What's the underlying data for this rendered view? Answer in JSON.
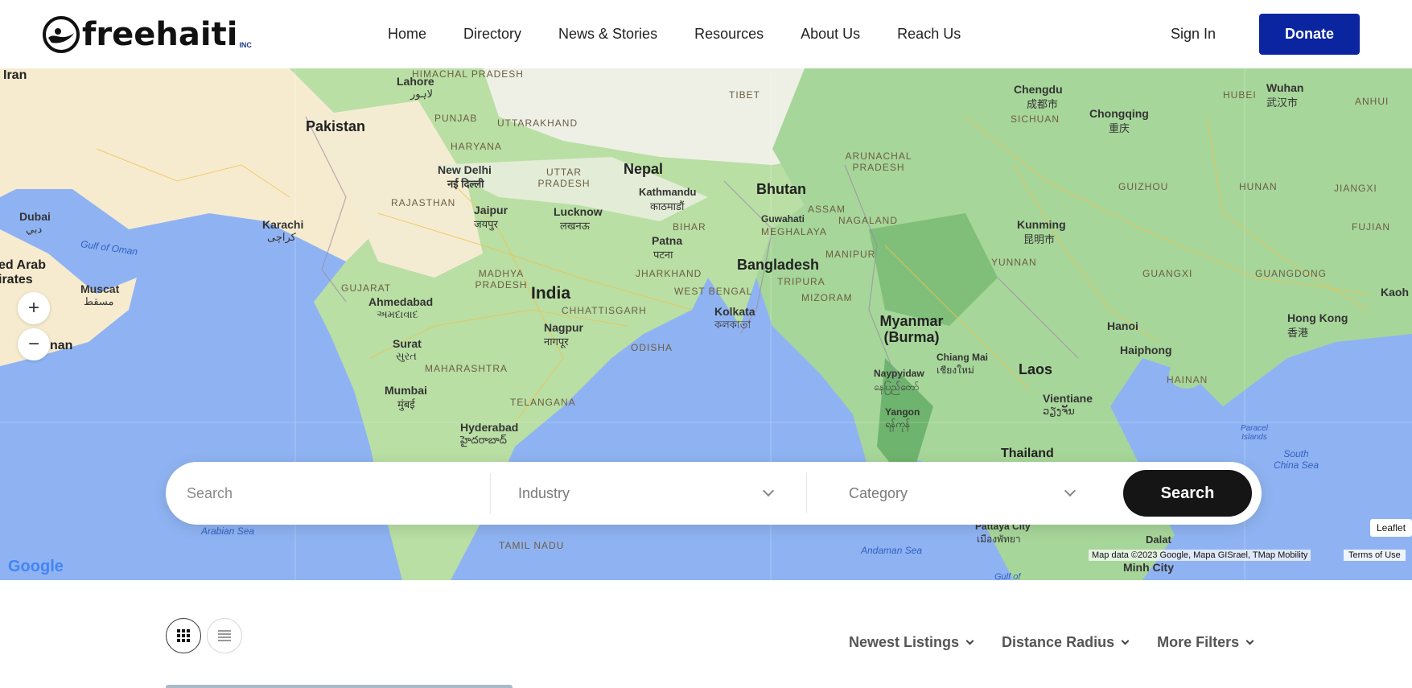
{
  "brand": {
    "name_main": "freehait",
    "name_i": "i",
    "suffix": "INC",
    "accent": "#0b24a0"
  },
  "nav": {
    "items": [
      "Home",
      "Directory",
      "News & Stories",
      "Resources",
      "About Us",
      "Reach Us"
    ],
    "sign_in": "Sign In",
    "donate": "Donate"
  },
  "map": {
    "countries": [
      "Iran",
      "Pakistan",
      "India",
      "Nepal",
      "Bhutan",
      "Bangladesh",
      "Myanmar (Burma)",
      "Laos",
      "Thailand"
    ],
    "cities": [
      {
        "name": "Lahore",
        "native": "لاہور"
      },
      {
        "name": "New Delhi",
        "native": "नई दिल्ली"
      },
      {
        "name": "Karachi",
        "native": "کراچی"
      },
      {
        "name": "Jaipur",
        "native": "जयपुर"
      },
      {
        "name": "Lucknow",
        "native": "लखनऊ"
      },
      {
        "name": "Kathmandu",
        "native": "काठमाडौं"
      },
      {
        "name": "Patna",
        "native": "पटना"
      },
      {
        "name": "Guwahati",
        "native": ""
      },
      {
        "name": "Ahmedabad",
        "native": "અમદાવાદ"
      },
      {
        "name": "Kolkata",
        "native": "কলকাতা"
      },
      {
        "name": "Nagpur",
        "native": "नागपूर"
      },
      {
        "name": "Surat",
        "native": "સુરત"
      },
      {
        "name": "Mumbai",
        "native": "मुंबई"
      },
      {
        "name": "Hyderabad",
        "native": "హైదరాబాద్"
      },
      {
        "name": "Dubai",
        "native": "دبي"
      },
      {
        "name": "Muscat",
        "native": "مسقط"
      },
      {
        "name": "Chengdu",
        "native": "成都市"
      },
      {
        "name": "Chongqing",
        "native": "重庆"
      },
      {
        "name": "Wuhan",
        "native": "武汉市"
      },
      {
        "name": "Kunming",
        "native": "昆明市"
      },
      {
        "name": "Hanoi",
        "native": ""
      },
      {
        "name": "Haiphong",
        "native": ""
      },
      {
        "name": "Hong Kong",
        "native": "香港"
      },
      {
        "name": "Naypyidaw",
        "native": "နေပြည်တော်"
      },
      {
        "name": "Chiang Mai",
        "native": "เชียงใหม่"
      },
      {
        "name": "Vientiane",
        "native": "ວຽງຈັນ"
      },
      {
        "name": "Yangon",
        "native": "ရန်ကုန်"
      },
      {
        "name": "Pattaya City",
        "native": "เมืองพัทยา"
      },
      {
        "name": "Dalat",
        "native": ""
      },
      {
        "name": "Minh City",
        "native": ""
      },
      {
        "name": "Kaoh",
        "native": ""
      }
    ],
    "regions": [
      "HIMACHAL PRADESH",
      "PUNJAB",
      "UTTARAKHAND",
      "HARYANA",
      "UTTAR PRADESH",
      "RAJASTHAN",
      "TIBET",
      "ARUNACHAL PRADESH",
      "ASSAM",
      "NAGALAND",
      "MEGHALAYA",
      "MANIPUR",
      "TRIPURA",
      "MIZORAM",
      "BIHAR",
      "JHARKHAND",
      "WEST BENGAL",
      "MADHYA PRADESH",
      "CHHATTISGARH",
      "GUJARAT",
      "ODISHA",
      "MAHARASHTRA",
      "TELANGANA",
      "TAMIL NADU",
      "SICHUAN",
      "HUBEI",
      "ANHUI",
      "GUIZHOU",
      "HUNAN",
      "JIANGXI",
      "YUNNAN",
      "GUANGXI",
      "GUANGDONG",
      "FUJIAN",
      "HAINAN"
    ],
    "seas": [
      "Gulf of Oman",
      "Arabian Sea",
      "Andaman Sea",
      "South China Sea",
      "Paracel Islands",
      "Gulf of"
    ],
    "edge_labels": [
      "ed Arab",
      "irates",
      "nan"
    ],
    "zoom_in": "+",
    "zoom_out": "−",
    "google": "Google",
    "attribution": "Map data ©2023 Google, Mapa GISrael, TMap Mobility",
    "terms": "Terms of Use",
    "leaflet": "Leaflet"
  },
  "search": {
    "placeholder": "Search",
    "industry": "Industry",
    "category": "Category",
    "button": "Search"
  },
  "listing_controls": {
    "grid_icon": "grid-icon",
    "list_icon": "list-icon",
    "filters": [
      "Newest Listings",
      "Distance Radius",
      "More Filters"
    ]
  }
}
